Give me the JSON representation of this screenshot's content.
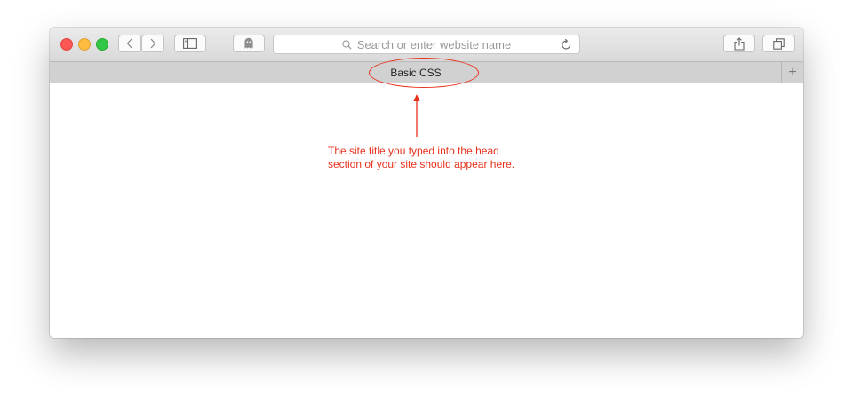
{
  "browser": {
    "address_placeholder": "Search or enter website name",
    "tab_title": "Basic CSS",
    "new_tab_symbol": "+"
  },
  "annotation": {
    "line1": "The site title you typed into the head",
    "line2": "section of your site should appear here.",
    "color": "#e8311c"
  },
  "icons": [
    "back-icon",
    "forward-icon",
    "sidebar-icon",
    "privacy-icon",
    "search-icon",
    "reload-icon",
    "share-icon",
    "tabs-overview-icon",
    "plus-icon"
  ]
}
